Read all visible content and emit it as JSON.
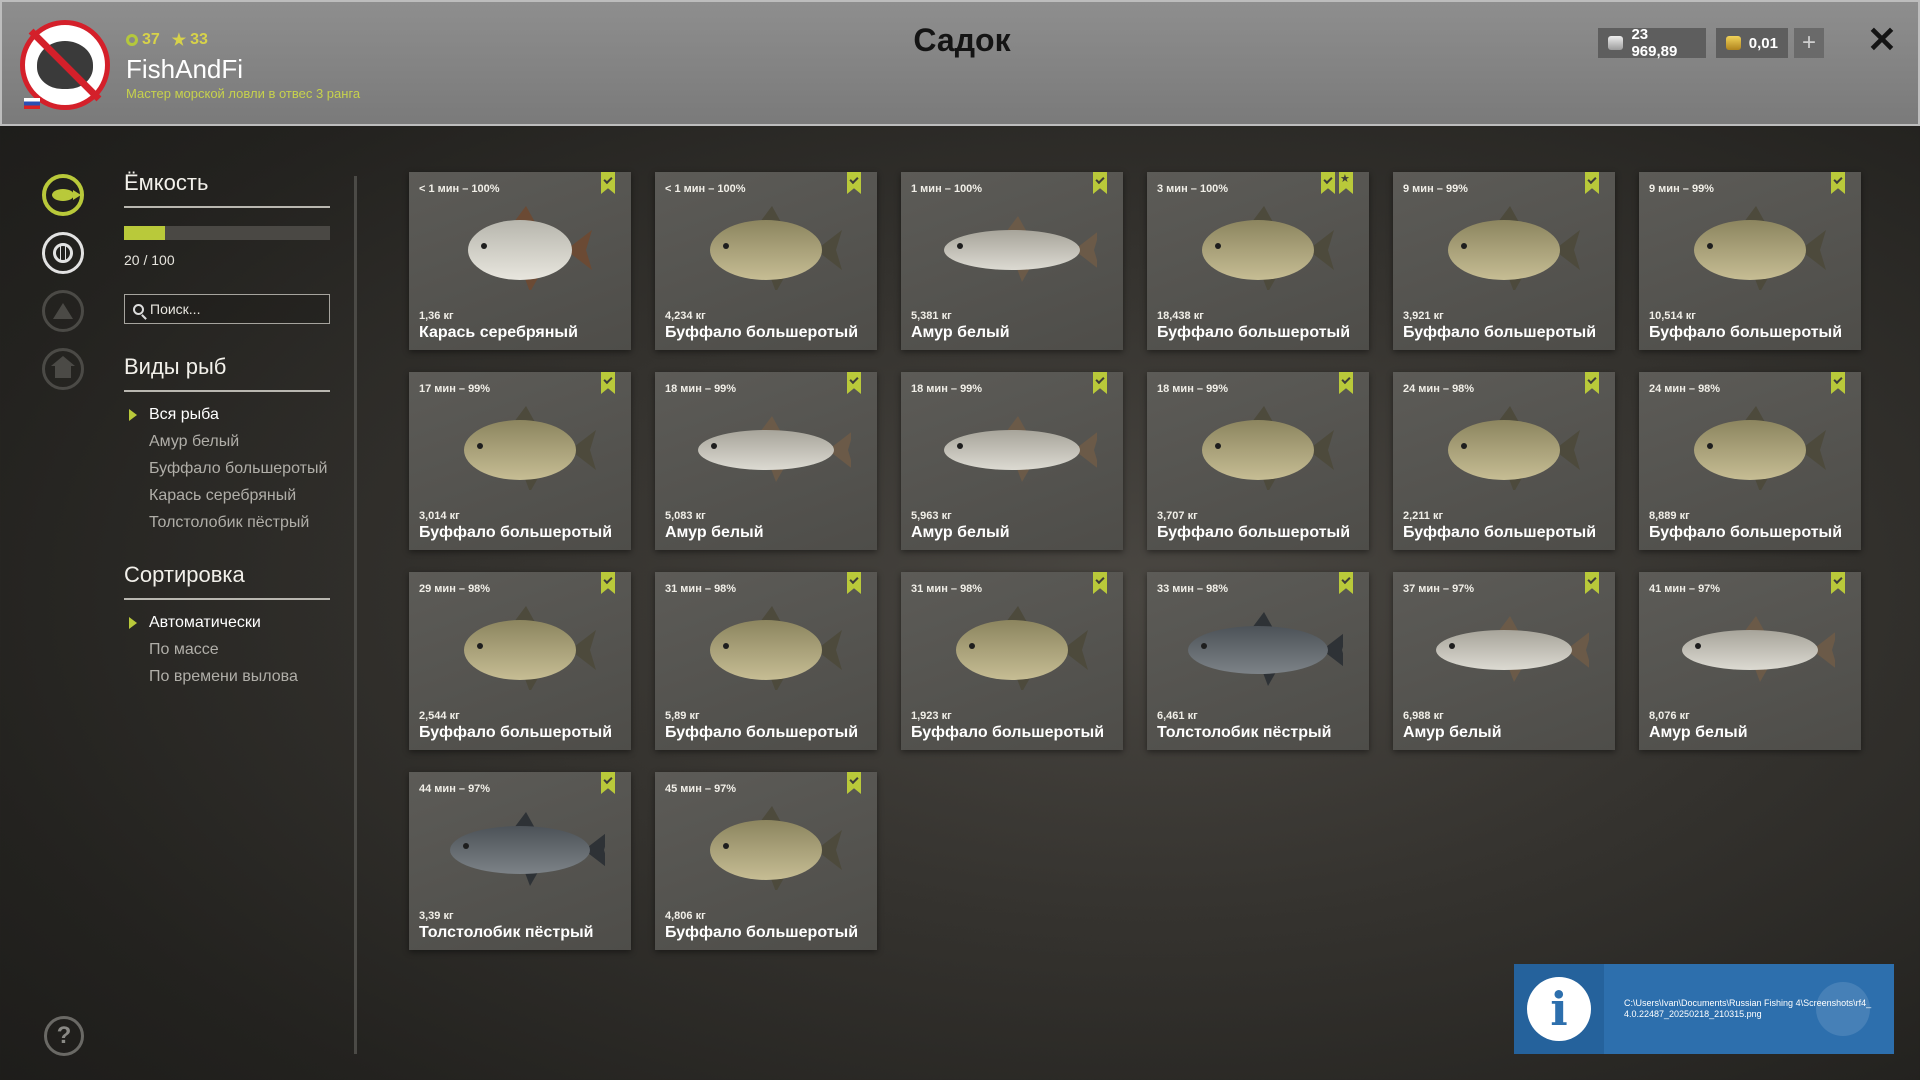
{
  "header": {
    "title": "Садок",
    "player": {
      "name": "FishAndFi",
      "rank": "Мастер морской ловли в отвес 3 ранга",
      "level": "37",
      "stars": "33"
    },
    "currency": {
      "silver": "23 969,89",
      "gold": "0,01"
    },
    "plus_label": "+",
    "close_label": "✕"
  },
  "sidebar": {
    "capacity": {
      "title": "Ёмкость",
      "current": 20,
      "max": 100,
      "text": "20 / 100"
    },
    "search": {
      "placeholder": "Поиск..."
    },
    "fish_types": {
      "title": "Виды рыб",
      "items": [
        "Вся рыба",
        "Амур белый",
        "Буффало большеротый",
        "Карась серебряный",
        "Толстолобик пёстрый"
      ],
      "selected": 0
    },
    "sort": {
      "title": "Сортировка",
      "items": [
        "Автоматически",
        "По массе",
        "По времени вылова"
      ],
      "selected": 0
    }
  },
  "help_label": "?",
  "catch": [
    {
      "time": "< 1 мин – 100%",
      "weight": "1,36 кг",
      "name": "Карась серебряный",
      "species": "carp",
      "star": false
    },
    {
      "time": "< 1 мин – 100%",
      "weight": "4,234 кг",
      "name": "Буффало большеротый",
      "species": "buffalo",
      "star": false
    },
    {
      "time": "1 мин – 100%",
      "weight": "5,381 кг",
      "name": "Амур белый",
      "species": "amur",
      "star": false
    },
    {
      "time": "3 мин – 100%",
      "weight": "18,438 кг",
      "name": "Буффало большеротый",
      "species": "buffalo",
      "star": true
    },
    {
      "time": "9 мин – 99%",
      "weight": "3,921 кг",
      "name": "Буффало большеротый",
      "species": "buffalo",
      "star": false
    },
    {
      "time": "9 мин – 99%",
      "weight": "10,514 кг",
      "name": "Буффало большеротый",
      "species": "buffalo",
      "star": false
    },
    {
      "time": "17 мин – 99%",
      "weight": "3,014 кг",
      "name": "Буффало большеротый",
      "species": "buffalo",
      "star": false
    },
    {
      "time": "18 мин – 99%",
      "weight": "5,083 кг",
      "name": "Амур белый",
      "species": "amur",
      "star": false
    },
    {
      "time": "18 мин – 99%",
      "weight": "5,963 кг",
      "name": "Амур белый",
      "species": "amur",
      "star": false
    },
    {
      "time": "18 мин – 99%",
      "weight": "3,707 кг",
      "name": "Буффало большеротый",
      "species": "buffalo",
      "star": false
    },
    {
      "time": "24 мин – 98%",
      "weight": "2,211 кг",
      "name": "Буффало большеротый",
      "species": "buffalo",
      "star": false
    },
    {
      "time": "24 мин – 98%",
      "weight": "8,889 кг",
      "name": "Буффало большеротый",
      "species": "buffalo",
      "star": false
    },
    {
      "time": "29 мин – 98%",
      "weight": "2,544 кг",
      "name": "Буффало большеротый",
      "species": "buffalo",
      "star": false
    },
    {
      "time": "31 мин – 98%",
      "weight": "5,89 кг",
      "name": "Буффало большеротый",
      "species": "buffalo",
      "star": false
    },
    {
      "time": "31 мин – 98%",
      "weight": "1,923 кг",
      "name": "Буффало большеротый",
      "species": "buffalo",
      "star": false
    },
    {
      "time": "33 мин – 98%",
      "weight": "6,461 кг",
      "name": "Толстолобик пёстрый",
      "species": "bighead",
      "star": false
    },
    {
      "time": "37 мин – 97%",
      "weight": "6,988 кг",
      "name": "Амур белый",
      "species": "amur",
      "star": false
    },
    {
      "time": "41 мин – 97%",
      "weight": "8,076 кг",
      "name": "Амур белый",
      "species": "amur",
      "star": false
    },
    {
      "time": "44 мин – 97%",
      "weight": "3,39 кг",
      "name": "Толстолобик пёстрый",
      "species": "bighead",
      "star": false
    },
    {
      "time": "45 мин – 97%",
      "weight": "4,806 кг",
      "name": "Буффало большеротый",
      "species": "buffalo",
      "star": false
    }
  ],
  "notification": {
    "text": "C:\\Users\\Ivan\\Documents\\Russian Fishing 4\\Screenshots\\rf4_4.0.22487_20250218_210315.png"
  },
  "colors": {
    "accent": "#b9c93a",
    "rank_text": "#c7d24c",
    "header_bg": "#858585",
    "card_bg": "#55544f",
    "notification_bg": "#2d6fad"
  }
}
